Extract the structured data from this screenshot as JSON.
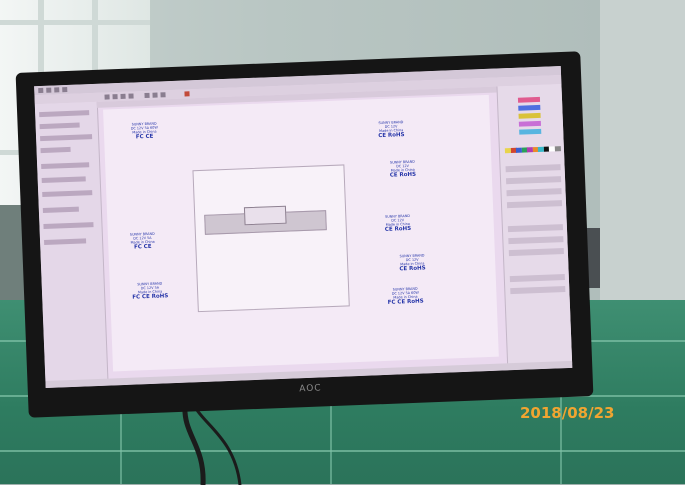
{
  "photo": {
    "date_stamp": "2018/08/23",
    "monitor_logo": "AOC"
  },
  "screen": {
    "labels": [
      {
        "id": "top-left",
        "lines": [
          "SUNNY BRAND",
          "DC 12V 5A 60W",
          "Made in China"
        ],
        "mark": "FC CE"
      },
      {
        "id": "top-right-1",
        "lines": [
          "SUNNY BRAND",
          "DC 12V",
          "Made in China"
        ],
        "mark": "CE RoHS"
      },
      {
        "id": "top-right-2",
        "lines": [
          "SUNNY BRAND",
          "DC 12V",
          "Made in China"
        ],
        "mark": "CE RoHS"
      },
      {
        "id": "mid-left",
        "lines": [
          "SUNNY BRAND",
          "DC 12V 5A",
          "Made in China"
        ],
        "mark": "FC CE"
      },
      {
        "id": "mid-right",
        "lines": [
          "SUNNY BRAND",
          "DC 12V",
          "Made in China"
        ],
        "mark": "CE RoHS"
      },
      {
        "id": "low-left",
        "lines": [
          "SUNNY BRAND",
          "DC 12V 5A",
          "Made in China"
        ],
        "mark": "FC CE RoHS"
      },
      {
        "id": "low-right-1",
        "lines": [
          "SUNNY BRAND",
          "DC 12V",
          "Made in China"
        ],
        "mark": "CE RoHS"
      },
      {
        "id": "low-right-2",
        "lines": [
          "SUNNY BRAND",
          "DC 12V 5A 60W",
          "Made in China"
        ],
        "mark": "FC CE RoHS"
      }
    ],
    "palette": [
      "#e8d44c",
      "#d2452f",
      "#3a5fd0",
      "#2aa05a",
      "#b23bb0",
      "#e98b2a",
      "#38b8c9",
      "#111111",
      "#ffffff",
      "#8a8a8a"
    ]
  }
}
